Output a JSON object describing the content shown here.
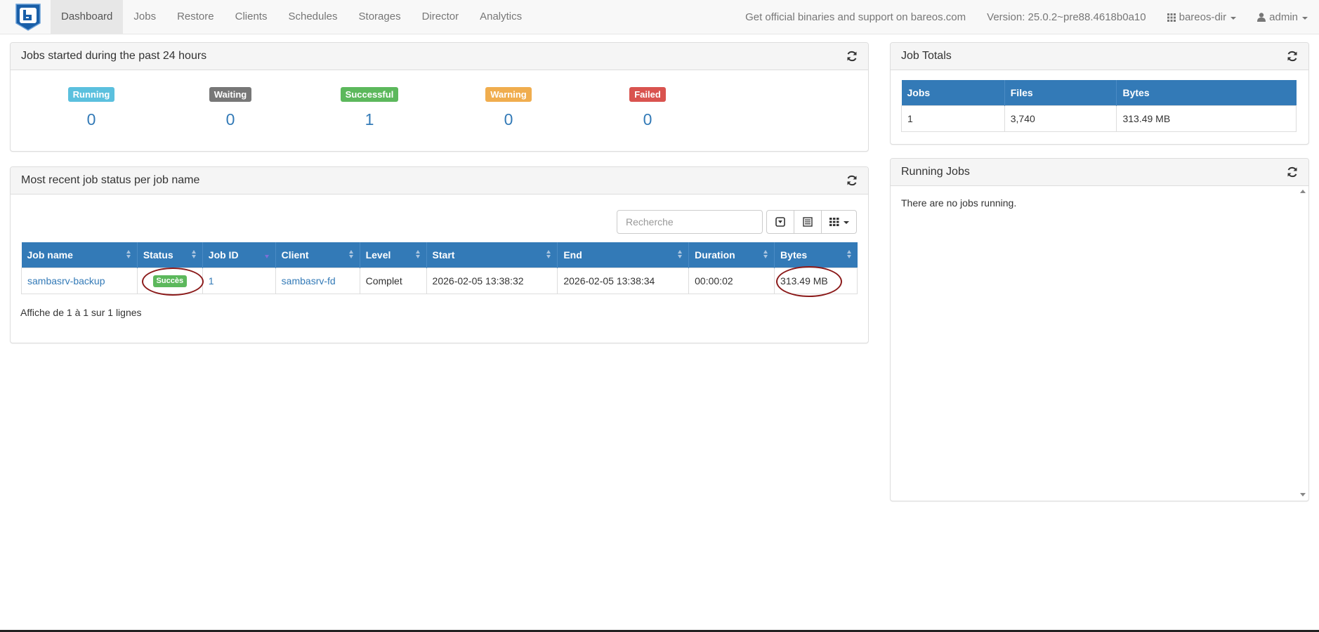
{
  "nav": {
    "items": [
      "Dashboard",
      "Jobs",
      "Restore",
      "Clients",
      "Schedules",
      "Storages",
      "Director",
      "Analytics"
    ],
    "support_text": "Get official binaries and support on bareos.com",
    "version": "Version: 25.0.2~pre88.4618b0a10",
    "director": "bareos-dir",
    "user": "admin"
  },
  "jobs24": {
    "title": "Jobs started during the past 24 hours",
    "stats": [
      {
        "label": "Running",
        "value": "0",
        "color": "#5bc0de"
      },
      {
        "label": "Waiting",
        "value": "0",
        "color": "#777777"
      },
      {
        "label": "Successful",
        "value": "1",
        "color": "#5cb85c"
      },
      {
        "label": "Warning",
        "value": "0",
        "color": "#f0ad4e"
      },
      {
        "label": "Failed",
        "value": "0",
        "color": "#d9534f"
      }
    ]
  },
  "recent": {
    "title": "Most recent job status per job name",
    "search_placeholder": "Recherche",
    "columns": [
      "Job name",
      "Status",
      "Job ID",
      "Client",
      "Level",
      "Start",
      "End",
      "Duration",
      "Bytes"
    ],
    "rows": [
      {
        "job_name": "sambasrv-backup",
        "status": "Succès",
        "job_id": "1",
        "client": "sambasrv-fd",
        "level": "Complet",
        "start": "2026-02-05 13:38:32",
        "end": "2026-02-05 13:38:34",
        "duration": "00:00:02",
        "bytes": "313.49 MB"
      }
    ],
    "footer": "Affiche de 1 à 1 sur 1 lignes"
  },
  "totals": {
    "title": "Job Totals",
    "columns": [
      "Jobs",
      "Files",
      "Bytes"
    ],
    "row": [
      "1",
      "3,740",
      "313.49 MB"
    ]
  },
  "running": {
    "title": "Running Jobs",
    "message": "There are no jobs running."
  },
  "colors": {
    "primary": "#337ab7",
    "annotation_ring": "#8b1a1a"
  }
}
